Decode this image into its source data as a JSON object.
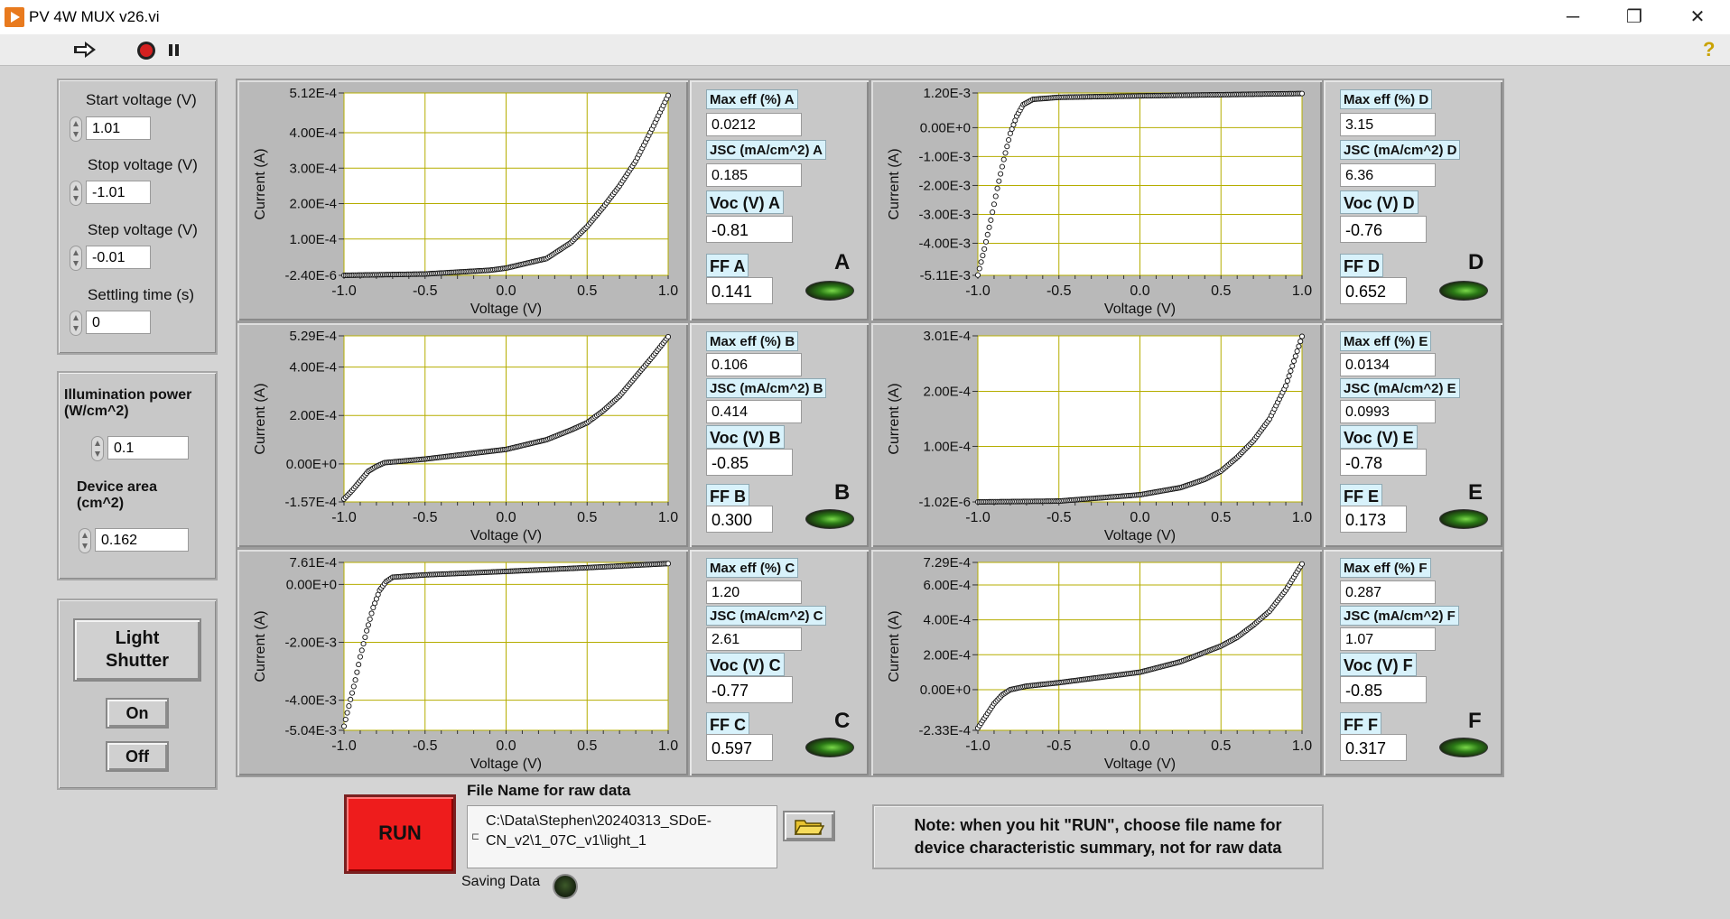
{
  "window": {
    "title": "PV 4W MUX v26.vi",
    "controls": {
      "minimize": "─",
      "restore": "❐",
      "close": "✕"
    }
  },
  "toolbar": {
    "run_icon": "run-arrow-icon",
    "abort_icon": "abort-icon",
    "pause_icon": "pause-icon",
    "help": "?"
  },
  "sweep": {
    "start_label": "Start voltage (V)",
    "start_value": "1.01",
    "stop_label": "Stop voltage (V)",
    "stop_value": "-1.01",
    "step_label": "Step voltage (V)",
    "step_value": "-0.01",
    "settle_label": "Settling time (s)",
    "settle_value": "0"
  },
  "illum": {
    "power_label": "Illumination power (W/cm^2)",
    "power_value": "0.1",
    "area_label": "Device area (cm^2)",
    "area_value": "0.162"
  },
  "shutter": {
    "label": "Light Shutter",
    "on": "On",
    "off": "Off"
  },
  "colors": {
    "plot_bg": "#ffffff",
    "grid": "#b5ad00",
    "led_on": "#4cc62a",
    "run": "#ee1c1c",
    "label_bg": "#d8f2fb"
  },
  "devices": [
    {
      "id": "A",
      "max_eff_label": "Max eff (%) A",
      "max_eff": "0.0212",
      "jsc_label": "JSC (mA/cm^2) A",
      "jsc": "0.185",
      "voc_label": "Voc (V) A",
      "voc": "-0.81",
      "ff_label": "FF A",
      "ff": "0.141"
    },
    {
      "id": "B",
      "max_eff_label": "Max eff (%) B",
      "max_eff": "0.106",
      "jsc_label": "JSC (mA/cm^2) B",
      "jsc": "0.414",
      "voc_label": "Voc (V) B",
      "voc": "-0.85",
      "ff_label": "FF B",
      "ff": "0.300"
    },
    {
      "id": "C",
      "max_eff_label": "Max eff (%) C",
      "max_eff": "1.20",
      "jsc_label": "JSC (mA/cm^2) C",
      "jsc": "2.61",
      "voc_label": "Voc (V) C",
      "voc": "-0.77",
      "ff_label": "FF C",
      "ff": "0.597"
    },
    {
      "id": "D",
      "max_eff_label": "Max eff (%) D",
      "max_eff": "3.15",
      "jsc_label": "JSC (mA/cm^2) D",
      "jsc": "6.36",
      "voc_label": "Voc (V) D",
      "voc": "-0.76",
      "ff_label": "FF D",
      "ff": "0.652"
    },
    {
      "id": "E",
      "max_eff_label": "Max eff (%) E",
      "max_eff": "0.0134",
      "jsc_label": "JSC (mA/cm^2) E",
      "jsc": "0.0993",
      "voc_label": "Voc (V) E",
      "voc": "-0.78",
      "ff_label": "FF E",
      "ff": "0.173"
    },
    {
      "id": "F",
      "max_eff_label": "Max eff (%) F",
      "max_eff": "0.287",
      "jsc_label": "JSC (mA/cm^2) F",
      "jsc": "1.07",
      "voc_label": "Voc (V) F",
      "voc": "-0.85",
      "ff_label": "FF F",
      "ff": "0.317"
    }
  ],
  "chart_data": [
    {
      "id": "A",
      "type": "scatter",
      "xlabel": "Voltage (V)",
      "ylabel": "Current (A)",
      "xlim": [
        -1.0,
        1.0
      ],
      "ylim": [
        -2.4e-06,
        0.000512
      ],
      "xticks": [
        "-1.0",
        "-0.5",
        "0.0",
        "0.5",
        "1.0"
      ],
      "yticks": [
        "-2.40E-6",
        "1.00E-4",
        "2.00E-4",
        "3.00E-4",
        "4.00E-4",
        "5.12E-4"
      ],
      "ytick_values": [
        -2.4e-06,
        0.0001,
        0.0002,
        0.0003,
        0.0004,
        0.000512
      ],
      "curve": [
        [
          -1.0,
          -2.4e-06
        ],
        [
          -0.5,
          1.4e-06
        ],
        [
          -0.1,
          1.2e-05
        ],
        [
          0.0,
          1.8e-05
        ],
        [
          0.25,
          4.5e-05
        ],
        [
          0.4,
          9e-05
        ],
        [
          0.5,
          0.000135
        ],
        [
          0.6,
          0.00019
        ],
        [
          0.7,
          0.00025
        ],
        [
          0.8,
          0.00032
        ],
        [
          0.9,
          0.00041
        ],
        [
          1.0,
          0.000505
        ]
      ]
    },
    {
      "id": "B",
      "type": "scatter",
      "xlabel": "Voltage (V)",
      "ylabel": "Current (A)",
      "xlim": [
        -1.0,
        1.0
      ],
      "ylim": [
        -0.000157,
        0.000529
      ],
      "xticks": [
        "-1.0",
        "-0.5",
        "0.0",
        "0.5",
        "1.0"
      ],
      "yticks": [
        "-1.57E-4",
        "0.00E+0",
        "2.00E-4",
        "4.00E-4",
        "5.29E-4"
      ],
      "ytick_values": [
        -0.000157,
        0.0,
        0.0002,
        0.0004,
        0.000529
      ],
      "curve": [
        [
          -1.0,
          -0.000145
        ],
        [
          -0.95,
          -0.00011
        ],
        [
          -0.9,
          -7e-05
        ],
        [
          -0.85,
          -3e-05
        ],
        [
          -0.8,
          -1e-05
        ],
        [
          -0.75,
          5e-06
        ],
        [
          -0.5,
          2e-05
        ],
        [
          0.0,
          6e-05
        ],
        [
          0.25,
          0.0001
        ],
        [
          0.4,
          0.00014
        ],
        [
          0.5,
          0.00017
        ],
        [
          0.6,
          0.00022
        ],
        [
          0.7,
          0.00028
        ],
        [
          0.8,
          0.00036
        ],
        [
          0.9,
          0.00044
        ],
        [
          1.0,
          0.000525
        ]
      ]
    },
    {
      "id": "C",
      "type": "scatter",
      "xlabel": "Voltage (V)",
      "ylabel": "Current (A)",
      "xlim": [
        -1.0,
        1.0
      ],
      "ylim": [
        -0.00504,
        0.000761
      ],
      "xticks": [
        "-1.0",
        "-0.5",
        "0.0",
        "0.5",
        "1.0"
      ],
      "yticks": [
        "-5.04E-3",
        "-4.00E-3",
        "-2.00E-3",
        "0.00E+0",
        "7.61E-4"
      ],
      "ytick_values": [
        -0.00504,
        -0.004,
        -0.002,
        0.0,
        0.000761
      ],
      "curve": [
        [
          -1.0,
          -0.0049
        ],
        [
          -0.97,
          -0.0042
        ],
        [
          -0.93,
          -0.0033
        ],
        [
          -0.9,
          -0.0025
        ],
        [
          -0.86,
          -0.0016
        ],
        [
          -0.82,
          -0.0008
        ],
        [
          -0.78,
          -0.0002
        ],
        [
          -0.74,
          0.0001
        ],
        [
          -0.7,
          0.00025
        ],
        [
          -0.5,
          0.00033
        ],
        [
          0.0,
          0.00045
        ],
        [
          0.5,
          0.00058
        ],
        [
          1.0,
          0.00072
        ]
      ]
    },
    {
      "id": "D",
      "type": "scatter",
      "xlabel": "Voltage (V)",
      "ylabel": "Current (A)",
      "xlim": [
        -1.0,
        1.0
      ],
      "ylim": [
        -0.00511,
        0.0012
      ],
      "xticks": [
        "-1.0",
        "-0.5",
        "0.0",
        "0.5",
        "1.0"
      ],
      "yticks": [
        "-5.11E-3",
        "-4.00E-3",
        "-3.00E-3",
        "-2.00E-3",
        "-1.00E-3",
        "0.00E+0",
        "1.20E-3"
      ],
      "ytick_values": [
        -0.00511,
        -0.004,
        -0.003,
        -0.002,
        -0.001,
        0.0,
        0.0012
      ],
      "curve": [
        [
          -1.0,
          -0.0051
        ],
        [
          -0.96,
          -0.0042
        ],
        [
          -0.92,
          -0.0032
        ],
        [
          -0.88,
          -0.0021
        ],
        [
          -0.84,
          -0.0011
        ],
        [
          -0.8,
          -0.0002
        ],
        [
          -0.76,
          0.0004
        ],
        [
          -0.72,
          0.0008
        ],
        [
          -0.66,
          0.00098
        ],
        [
          -0.5,
          0.00105
        ],
        [
          0.0,
          0.0011
        ],
        [
          0.5,
          0.00114
        ],
        [
          1.0,
          0.00118
        ]
      ]
    },
    {
      "id": "E",
      "type": "scatter",
      "xlabel": "Voltage (V)",
      "ylabel": "Current (A)",
      "xlim": [
        -1.0,
        1.0
      ],
      "ylim": [
        -1.02e-06,
        0.000301
      ],
      "xticks": [
        "-1.0",
        "-0.5",
        "0.0",
        "0.5",
        "1.0"
      ],
      "yticks": [
        "-1.02E-6",
        "1.00E-4",
        "2.00E-4",
        "3.01E-4"
      ],
      "ytick_values": [
        -1.02e-06,
        0.0001,
        0.0002,
        0.000301
      ],
      "curve": [
        [
          -1.0,
          -1e-06
        ],
        [
          -0.5,
          5e-07
        ],
        [
          0.0,
          1.2e-05
        ],
        [
          0.25,
          2.5e-05
        ],
        [
          0.4,
          4e-05
        ],
        [
          0.5,
          5.5e-05
        ],
        [
          0.6,
          8e-05
        ],
        [
          0.7,
          0.00011
        ],
        [
          0.8,
          0.00015
        ],
        [
          0.9,
          0.00021
        ],
        [
          1.0,
          0.0003
        ]
      ]
    },
    {
      "id": "F",
      "type": "scatter",
      "xlabel": "Voltage (V)",
      "ylabel": "Current (A)",
      "xlim": [
        -1.0,
        1.0
      ],
      "ylim": [
        -0.000233,
        0.000729
      ],
      "xticks": [
        "-1.0",
        "-0.5",
        "0.0",
        "0.5",
        "1.0"
      ],
      "yticks": [
        "-2.33E-4",
        "0.00E+0",
        "2.00E-4",
        "4.00E-4",
        "6.00E-4",
        "7.29E-4"
      ],
      "ytick_values": [
        -0.000233,
        0.0,
        0.0002,
        0.0004,
        0.0006,
        0.000729
      ],
      "curve": [
        [
          -1.0,
          -0.00022
        ],
        [
          -0.95,
          -0.00015
        ],
        [
          -0.9,
          -8e-05
        ],
        [
          -0.85,
          -3e-05
        ],
        [
          -0.8,
          0.0
        ],
        [
          -0.7,
          2e-05
        ],
        [
          -0.5,
          4e-05
        ],
        [
          0.0,
          0.0001
        ],
        [
          0.25,
          0.00016
        ],
        [
          0.5,
          0.00025
        ],
        [
          0.6,
          0.0003
        ],
        [
          0.7,
          0.00037
        ],
        [
          0.8,
          0.00045
        ],
        [
          0.9,
          0.00057
        ],
        [
          1.0,
          0.00072
        ]
      ]
    }
  ],
  "file": {
    "label": "File Name for raw data",
    "path_line1": "C:\\Data\\Stephen\\20240313_SDoE-",
    "path_line2": "CN_v2\\1_07C_v1\\light_1",
    "saving_label": "Saving Data"
  },
  "run": {
    "label": "RUN"
  },
  "note": {
    "line1": "Note: when you hit \"RUN\", choose file name for",
    "line2": "device characteristic summary, not for raw data"
  }
}
